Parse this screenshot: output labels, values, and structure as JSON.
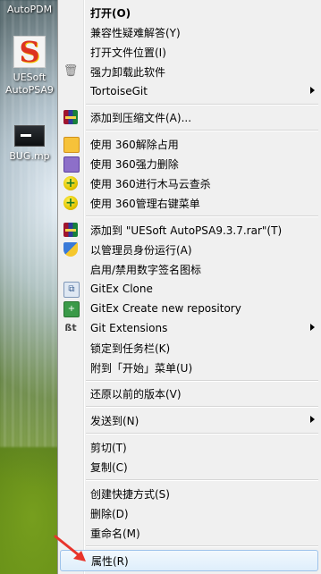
{
  "desktop": {
    "icons": [
      {
        "name": "autopdm",
        "label": "AutoPDM"
      },
      {
        "name": "uesoft",
        "label_line1": "UESoft",
        "label_line2": "AutoPSA9"
      },
      {
        "name": "bug",
        "label": "BUG.mp"
      }
    ]
  },
  "menu": {
    "items": [
      {
        "label": "打开(O)",
        "bold": true
      },
      {
        "label": "兼容性疑难解答(Y)"
      },
      {
        "label": "打开文件位置(I)"
      },
      {
        "label": "强力卸载此软件",
        "icon": "trash-icon"
      },
      {
        "label": "TortoiseGit",
        "submenu": true
      },
      {
        "label": "添加到压缩文件(A)...",
        "icon": "winrar-icon"
      },
      {
        "label": "使用 360解除占用",
        "icon": "360-unlock-icon"
      },
      {
        "label": "使用 360强力删除",
        "icon": "360-delete-icon"
      },
      {
        "label": "使用 360进行木马云查杀",
        "icon": "360-scan-icon"
      },
      {
        "label": "使用 360管理右键菜单",
        "icon": "360-menu-icon"
      },
      {
        "label": "添加到 \"UESoft AutoPSA9.3.7.rar\"(T)",
        "icon": "winrar-icon"
      },
      {
        "label": "以管理员身份运行(A)",
        "icon": "uac-shield-icon"
      },
      {
        "label": "启用/禁用数字签名图标"
      },
      {
        "label": "GitEx Clone",
        "icon": "gitex-clone-icon"
      },
      {
        "label": "GitEx Create new repository",
        "icon": "gitex-create-icon"
      },
      {
        "label": "Git Extensions",
        "icon": "git-extensions-icon",
        "submenu": true
      },
      {
        "label": "锁定到任务栏(K)"
      },
      {
        "label": "附到「开始」菜单(U)"
      },
      {
        "label": "还原以前的版本(V)"
      },
      {
        "label": "发送到(N)",
        "submenu": true
      },
      {
        "label": "剪切(T)"
      },
      {
        "label": "复制(C)"
      },
      {
        "label": "创建快捷方式(S)"
      },
      {
        "label": "删除(D)"
      },
      {
        "label": "重命名(M)"
      },
      {
        "label": "属性(R)",
        "highlighted": true
      }
    ]
  },
  "annotation": {
    "arrow_color": "#e8342b"
  }
}
